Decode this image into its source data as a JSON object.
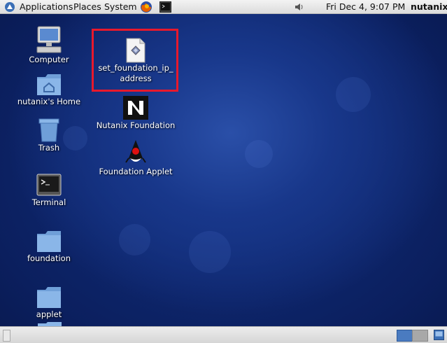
{
  "top_panel": {
    "menus": [
      "Applications",
      "Places",
      "System"
    ],
    "clock": "Fri Dec  4,  9:07 PM",
    "user": "nutanix"
  },
  "desktop": {
    "left_icons": [
      {
        "label": "Computer",
        "icon": "computer-icon"
      },
      {
        "label": "nutanix's Home",
        "icon": "home-folder-icon"
      },
      {
        "label": "Trash",
        "icon": "trash-icon"
      },
      {
        "label": "Terminal",
        "icon": "terminal-icon"
      },
      {
        "label": "foundation",
        "icon": "folder-icon"
      },
      {
        "label": "applet",
        "icon": "folder-icon"
      }
    ],
    "center_icons": [
      {
        "label_line1": "set_foundation_ip_",
        "label_line2": "address",
        "icon": "script-file-icon",
        "highlighted": true
      },
      {
        "label": "Nutanix Foundation",
        "icon": "nutanix-logo-icon"
      },
      {
        "label": "Foundation Applet",
        "icon": "java-duke-icon"
      }
    ],
    "highlight_color": "#e8192c"
  },
  "bottom_panel": {
    "workspaces": [
      "workspace-1",
      "workspace-2"
    ],
    "active_workspace": 1
  }
}
